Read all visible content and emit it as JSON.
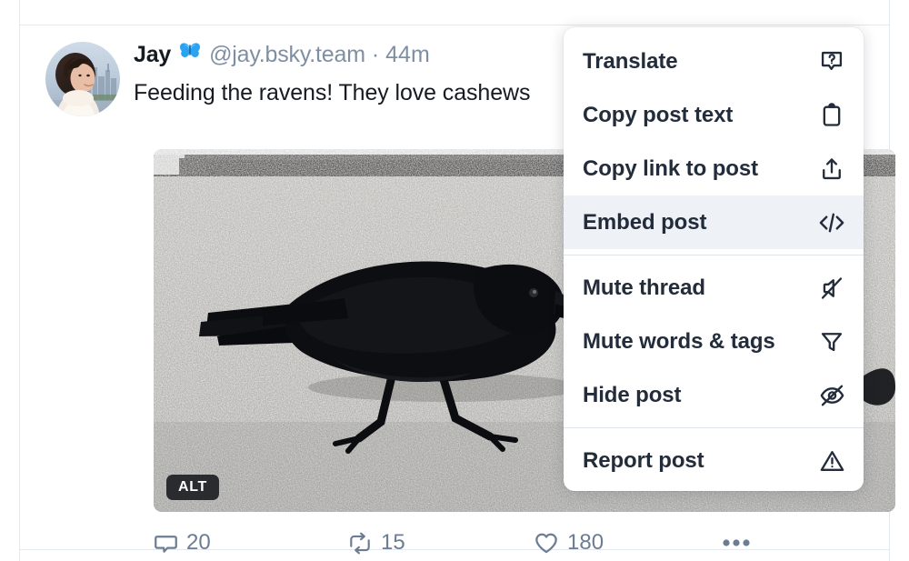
{
  "post": {
    "author": {
      "display_name": "Jay",
      "badge_icon": "butterfly-emoji",
      "handle": "@jay.bsky.team",
      "separator": "·",
      "timestamp": "44m",
      "avatar_icon": "user-avatar-photo"
    },
    "text": "Feeding the ravens! They love cashews",
    "media": {
      "alt_badge": "ALT",
      "description": "A black raven walking on a gravel rooftop",
      "image_icon": "raven-on-gravel-photo"
    },
    "engagement": [
      {
        "name": "reply",
        "icon": "comment-icon",
        "count": "20"
      },
      {
        "name": "repost",
        "icon": "repost-icon",
        "count": "15"
      },
      {
        "name": "like",
        "icon": "heart-icon",
        "count": "180"
      },
      {
        "name": "more",
        "icon": "ellipsis-icon",
        "count": ""
      }
    ]
  },
  "menu": {
    "items": [
      {
        "label": "Translate",
        "icon": "translate-icon",
        "highlighted": false
      },
      {
        "label": "Copy post text",
        "icon": "clipboard-icon",
        "highlighted": false
      },
      {
        "label": "Copy link to post",
        "icon": "share-icon",
        "highlighted": false
      },
      {
        "label": "Embed post",
        "icon": "code-icon",
        "highlighted": true
      },
      {
        "label": "Mute thread",
        "icon": "mute-icon",
        "highlighted": false
      },
      {
        "label": "Mute words & tags",
        "icon": "filter-icon",
        "highlighted": false
      },
      {
        "label": "Hide post",
        "icon": "eye-off-icon",
        "highlighted": false
      },
      {
        "label": "Report post",
        "icon": "warning-icon",
        "highlighted": false
      }
    ]
  },
  "colors": {
    "text_primary": "#161b22",
    "text_muted": "#7f8fa3",
    "menu_text": "#232c3b",
    "menu_highlight": "#eef1f5",
    "engagement": "#6c7d93",
    "border": "#e4e8ef",
    "badge_blue": "#3aabff"
  }
}
